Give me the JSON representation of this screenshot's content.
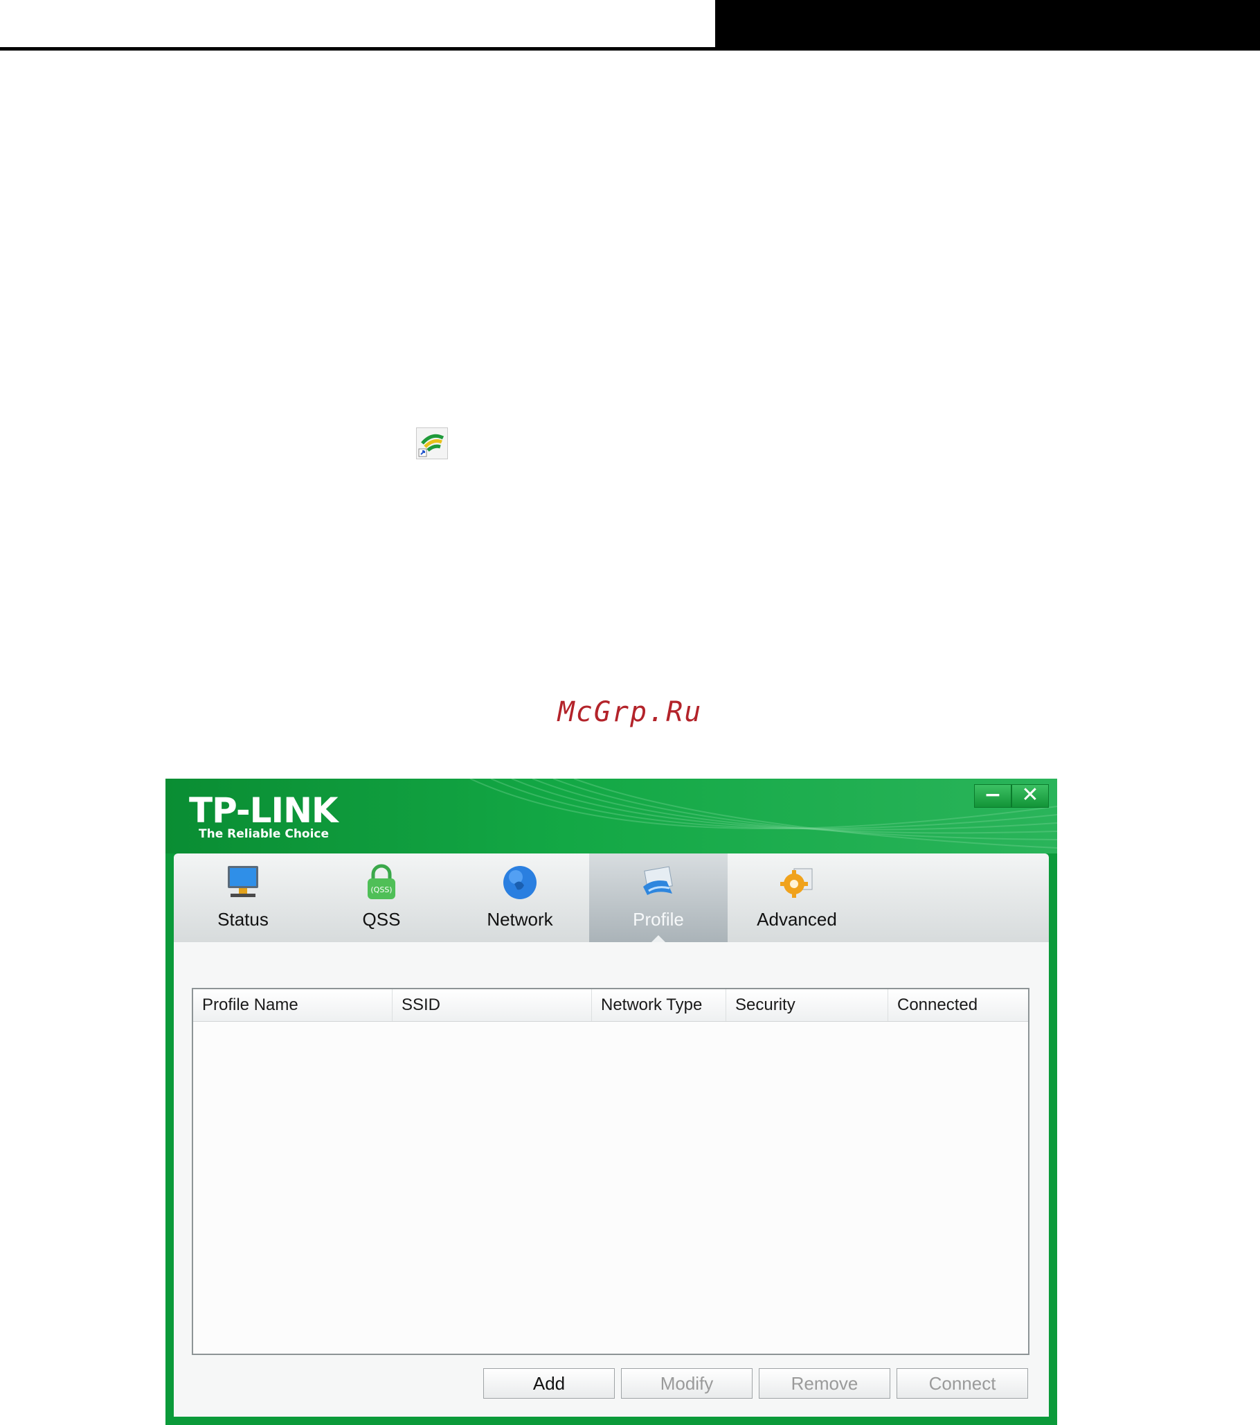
{
  "app": {
    "brand_name": "TP-LINK",
    "brand_tagline": "The Reliable Choice",
    "minimize_glyph": "−",
    "close_glyph": "✕"
  },
  "watermark": "McGrp.Ru",
  "tabs": [
    {
      "label": "Status",
      "icon": "monitor-icon",
      "active": false
    },
    {
      "label": "QSS",
      "icon": "qss-lock-icon",
      "active": false
    },
    {
      "label": "Network",
      "icon": "globe-icon",
      "active": false
    },
    {
      "label": "Profile",
      "icon": "profile-icon",
      "active": true
    },
    {
      "label": "Advanced",
      "icon": "gear-icon",
      "active": false
    }
  ],
  "table": {
    "columns": [
      "Profile Name",
      "SSID",
      "Network Type",
      "Security",
      "Connected"
    ],
    "rows": []
  },
  "buttons": {
    "add": "Add",
    "modify": "Modify",
    "remove": "Remove",
    "connect": "Connect"
  },
  "colors": {
    "window_green": "#0b9a3a",
    "watermark_red": "#b3232a"
  }
}
